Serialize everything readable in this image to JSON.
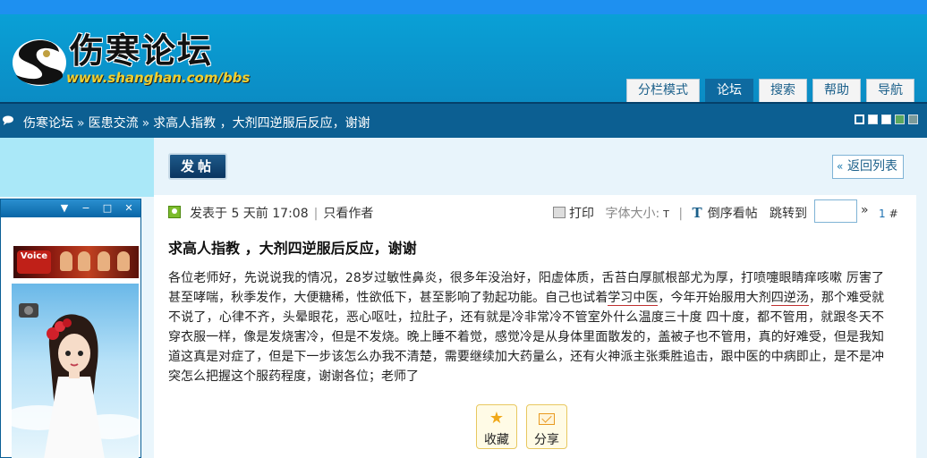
{
  "header": {
    "site_title": "伤寒论坛",
    "site_url": "www.shanghan.com/bbs",
    "nav": [
      "分栏模式",
      "论坛",
      "搜索",
      "帮助",
      "导航"
    ],
    "active_nav": "论坛"
  },
  "breadcrumb": {
    "items": [
      "伤寒论坛",
      "医患交流",
      "求高人指教 ，大剂四逆服后反应，谢谢"
    ],
    "separator": "»"
  },
  "theme_swatches": [
    "#ffffff",
    "#ffffff",
    "#ffffff",
    "#5aa860",
    "#7a9a9a"
  ],
  "float_window": {
    "banner_logo_text": "Voice",
    "controls": [
      "▼",
      "−",
      "□",
      "✕"
    ]
  },
  "toolbar": {
    "post_label": "发帖",
    "back_label": "返回列表",
    "back_chevron": "«"
  },
  "post_meta": {
    "posted": "发表于 5 天前 17:08",
    "only_author": "只看作者",
    "print": "打印",
    "font_size_label": "字体大小:",
    "font_size_t": "T",
    "reverse": "倒序看帖",
    "jump_label": "跳转到",
    "jump_arrow": "»",
    "floor_num": "1",
    "floor_hash": "#"
  },
  "post": {
    "title": "求高人指教 ，大剂四逆服后反应，谢谢",
    "content_before_link1": "各位老师好，先说说我的情况，28岁过敏性鼻炎，很多年没治好，阳虚体质，舌苔白厚腻根部尤为厚，打喷嚏眼睛痒咳嗽 厉害了甚至哮喘，秋季发作，大便糖稀，性欲低下，甚至影响了勃起功能。自己也试着",
    "link1": "学习中医",
    "content_between": "，今年开始服用大剂",
    "link2": "四逆汤",
    "content_after": "，那个难受就不说了，心律不齐，头晕眼花，恶心呕吐，拉肚子，还有就是冷非常冷不管室外什么温度三十度 四十度，都不管用，就跟冬天不穿衣服一样，像是发烧害冷，但是不发烧。晚上睡不着觉，感觉冷是从身体里面散发的，盖被子也不管用，真的好难受，但是我知道这真是对症了，但是下一步该怎么办我不清楚，需要继续加大药量么，还有火神派主张乘胜追击，跟中医的中病即止，是不是冲突怎么把握这个服药程度，谢谢各位；老师了"
  },
  "share": {
    "favorite": "收藏",
    "share": "分享"
  },
  "colors": {
    "topbar": "#1e90f0",
    "header": "#0aa0d6",
    "crumbbar": "#0c5f92",
    "accent": "#1a5f8a"
  }
}
